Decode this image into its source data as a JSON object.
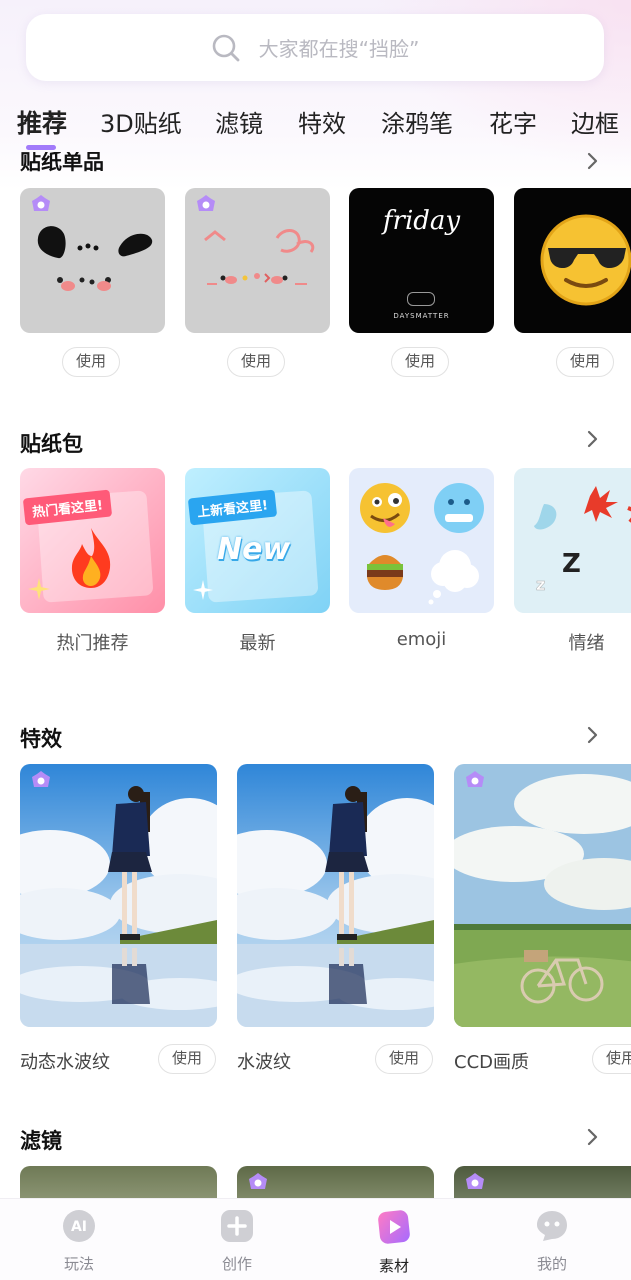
{
  "search": {
    "placeholder": "大家都在搜“挡脸”"
  },
  "tabs": [
    {
      "label": "推荐",
      "active": true
    },
    {
      "label": "3D贴纸",
      "active": false
    },
    {
      "label": "滤镜",
      "active": false
    },
    {
      "label": "特效",
      "active": false
    },
    {
      "label": "涂鸦笔",
      "active": false
    },
    {
      "label": "花字",
      "active": false
    },
    {
      "label": "边框",
      "active": false
    }
  ],
  "sections": {
    "single_stickers": {
      "title": "贴纸单品",
      "items": [
        {
          "use_label": "使用",
          "vip": true
        },
        {
          "use_label": "使用",
          "vip": true
        },
        {
          "use_label": "使用",
          "vip": false,
          "card_text": "friday",
          "card_subtext": "DAYSMATTER"
        },
        {
          "use_label": "使用",
          "vip": false
        }
      ]
    },
    "sticker_packs": {
      "title": "贴纸包",
      "items": [
        {
          "label": "热门推荐",
          "card_text": "热门看这里!"
        },
        {
          "label": "最新",
          "card_text": "上新看这里!",
          "badge": "New"
        },
        {
          "label": "emoji"
        },
        {
          "label": "情绪"
        }
      ]
    },
    "effects": {
      "title": "特效",
      "items": [
        {
          "label": "动态水波纹",
          "use_label": "使用",
          "vip": true
        },
        {
          "label": "水波纹",
          "use_label": "使用",
          "vip": false
        },
        {
          "label": "CCD画质",
          "use_label": "使用",
          "vip": true
        }
      ]
    },
    "filters": {
      "title": "滤镜",
      "items": [
        {
          "vip": false
        },
        {
          "vip": true
        },
        {
          "vip": true
        }
      ]
    }
  },
  "bottom_nav": [
    {
      "label": "玩法",
      "icon": "ai-icon",
      "icon_text": "AI",
      "active": false
    },
    {
      "label": "创作",
      "icon": "plus-icon",
      "active": false
    },
    {
      "label": "素材",
      "icon": "material-icon",
      "active": true
    },
    {
      "label": "我的",
      "icon": "chat-face-icon",
      "active": false
    }
  ],
  "colors": {
    "accent": "#a27bfa",
    "vip_badge": "#b58cf7",
    "material_icon": "#ff4fa0"
  }
}
